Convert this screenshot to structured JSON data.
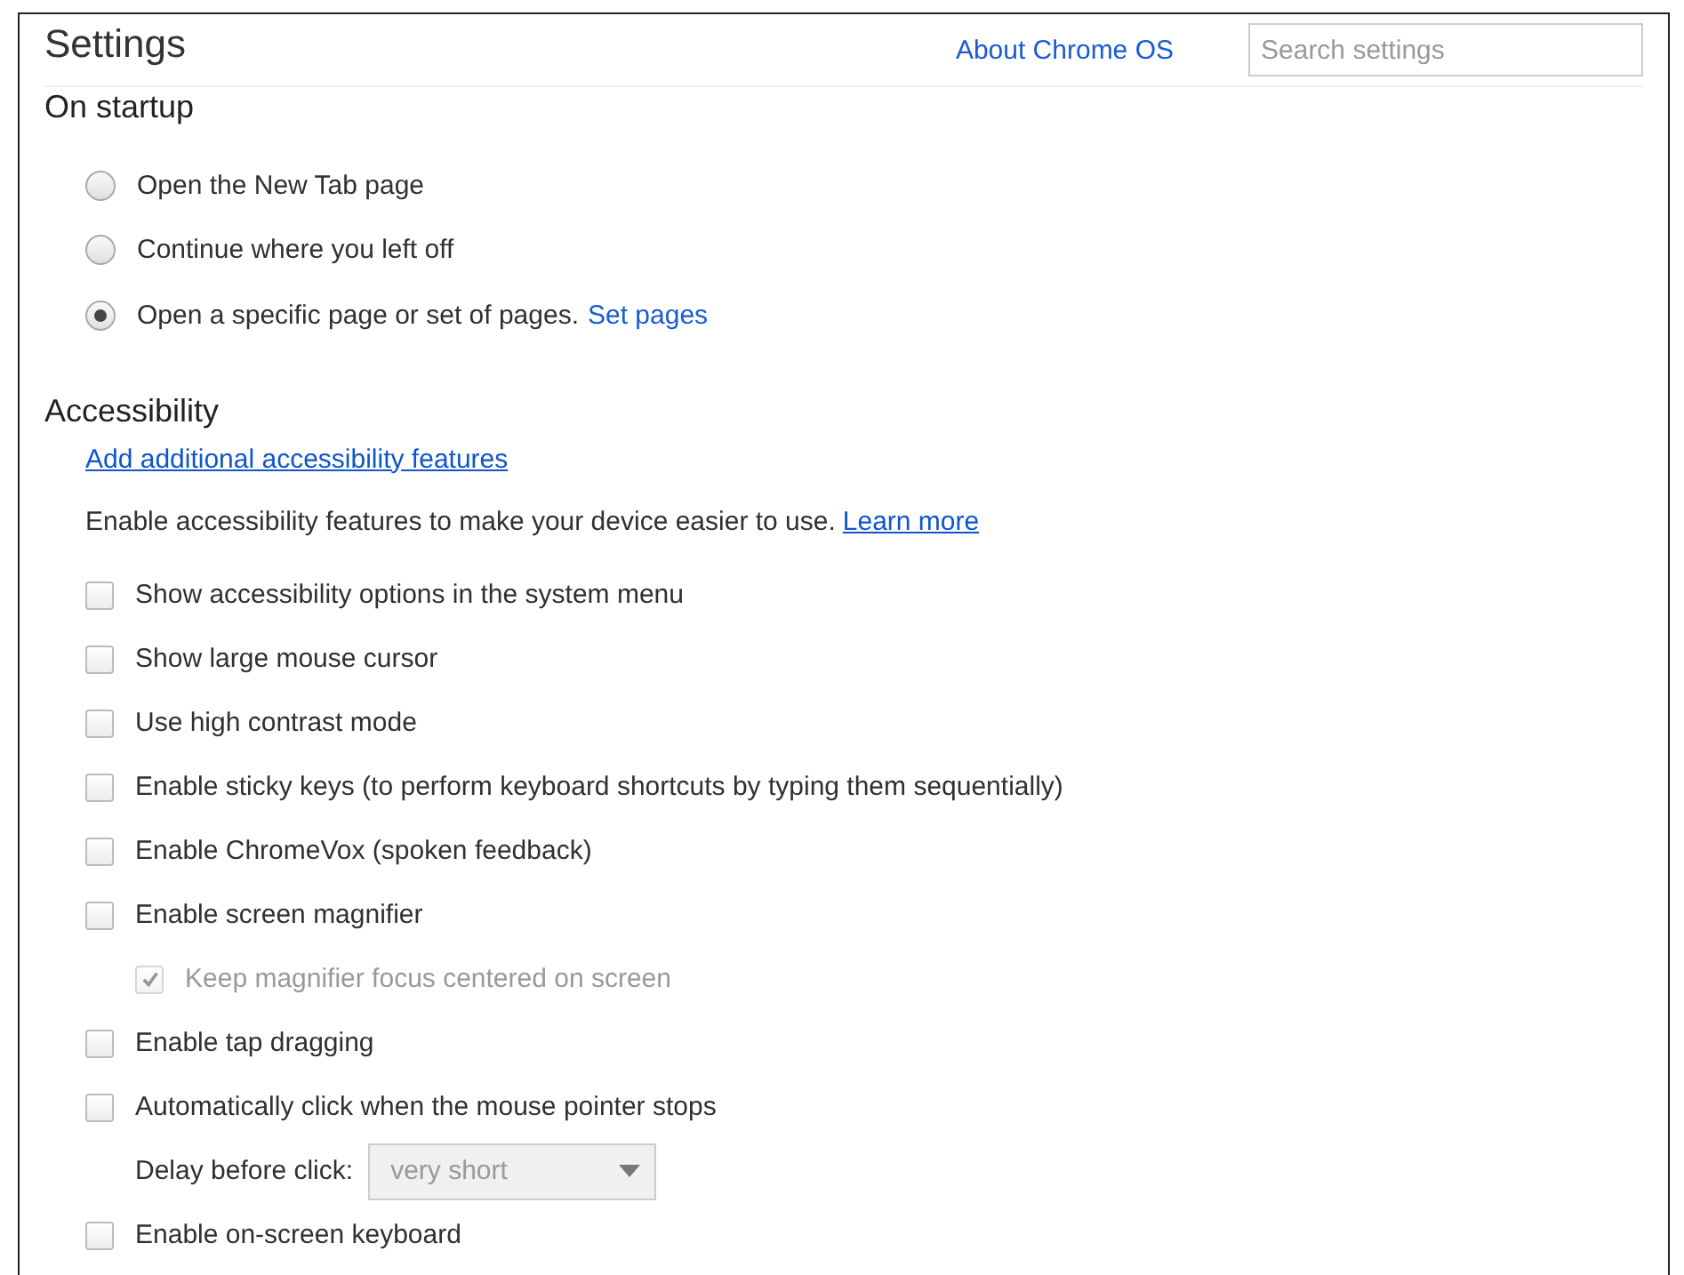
{
  "header": {
    "title": "Settings",
    "about_link": "About Chrome OS",
    "search": {
      "placeholder": "Search settings"
    }
  },
  "startup": {
    "heading": "On startup",
    "options": [
      {
        "label": "Open the New Tab page",
        "selected": false
      },
      {
        "label": "Continue where you left off",
        "selected": false
      },
      {
        "label": "Open a specific page or set of pages.",
        "link": "Set pages",
        "selected": true
      }
    ]
  },
  "accessibility": {
    "heading": "Accessibility",
    "add_link": "Add additional accessibility features",
    "description": "Enable accessibility features to make your device easier to use.",
    "learn_more": "Learn more",
    "items": [
      {
        "kind": "checkbox",
        "label": "Show accessibility options in the system menu",
        "checked": false,
        "disabled": false
      },
      {
        "kind": "checkbox",
        "label": "Show large mouse cursor",
        "checked": false,
        "disabled": false
      },
      {
        "kind": "checkbox",
        "label": "Use high contrast mode",
        "checked": false,
        "disabled": false
      },
      {
        "kind": "checkbox",
        "label": "Enable sticky keys (to perform keyboard shortcuts by typing them sequentially)",
        "checked": false,
        "disabled": false
      },
      {
        "kind": "checkbox",
        "label": "Enable ChromeVox (spoken feedback)",
        "checked": false,
        "disabled": false
      },
      {
        "kind": "checkbox",
        "label": "Enable screen magnifier",
        "checked": false,
        "disabled": false,
        "children": [
          {
            "kind": "checkbox",
            "label": "Keep magnifier focus centered on screen",
            "checked": true,
            "disabled": true
          }
        ]
      },
      {
        "kind": "checkbox",
        "label": "Enable tap dragging",
        "checked": false,
        "disabled": false
      },
      {
        "kind": "checkbox",
        "label": "Automatically click when the mouse pointer stops",
        "checked": false,
        "disabled": false,
        "children": [
          {
            "kind": "dropdown",
            "label": "Delay before click:",
            "value": "very short",
            "disabled": true
          }
        ]
      },
      {
        "kind": "checkbox",
        "label": "Enable on-screen keyboard",
        "checked": false,
        "disabled": false
      }
    ]
  }
}
